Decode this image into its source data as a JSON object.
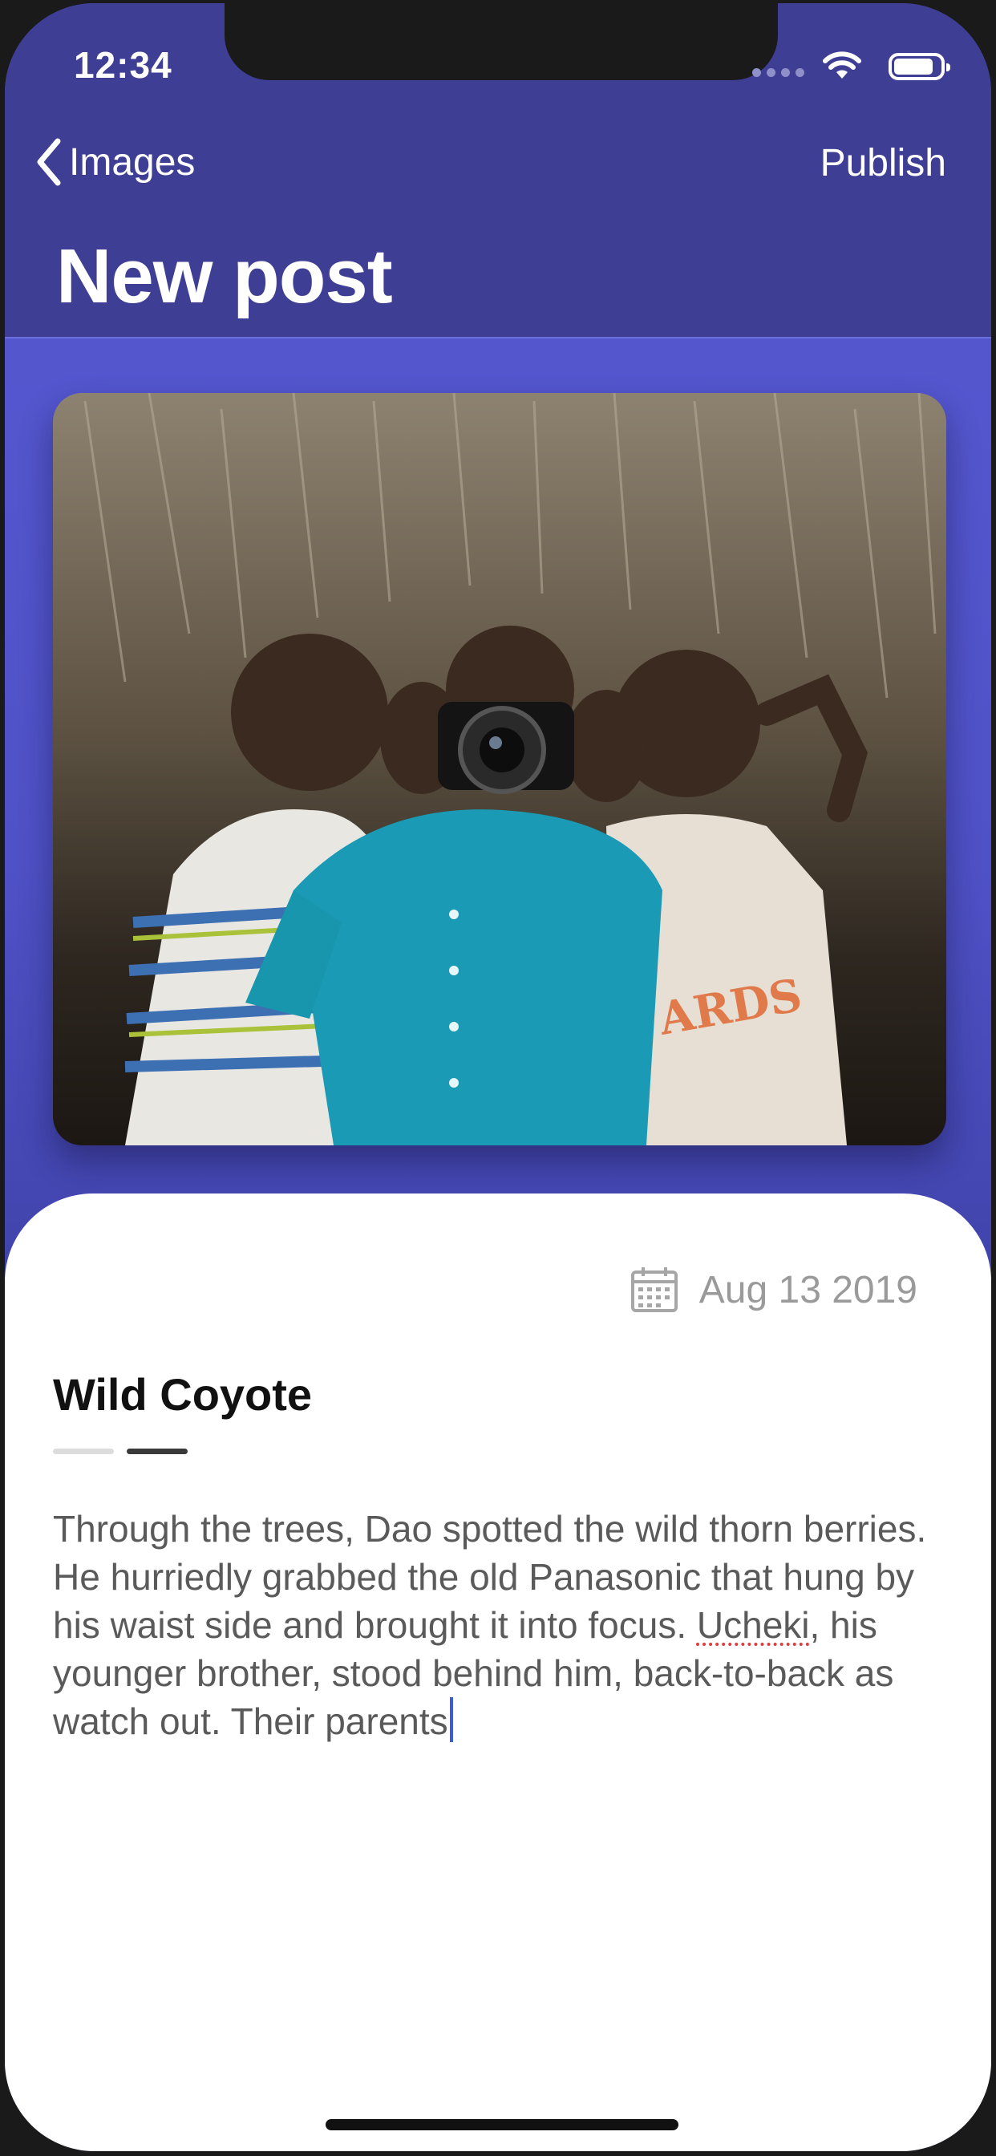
{
  "status_bar": {
    "time": "12:34",
    "battery_level": 0.85,
    "signal_icon": "cellular-signal-icon",
    "wifi_icon": "wifi-icon",
    "battery_icon": "battery-icon"
  },
  "nav": {
    "back_label": "Images",
    "back_icon": "chevron-left-icon",
    "publish_label": "Publish",
    "title": "New post"
  },
  "photo": {
    "icon": "photo-image",
    "subject": "three children, one holding a Nikon camera, in front of a thatched hut"
  },
  "post": {
    "date_icon": "calendar-icon",
    "date": "Aug 13 2019",
    "title": "Wild Coyote",
    "body_part1": "Through the trees, Dao spotted the wild thorn berries. He hurriedly grabbed the old Panasonic that hung by his waist side and brought it into focus. ",
    "body_misspelled": "Ucheki",
    "body_part2": ", his younger brother, stood behind him, back-to-back as watch out. Their parents"
  },
  "colors": {
    "nav_bg": "#3f3e95",
    "gradient_top": "#575ad4",
    "gradient_bottom": "#2f318a",
    "caret": "#3b5bdb",
    "spellcheck": "#e23b3b"
  }
}
